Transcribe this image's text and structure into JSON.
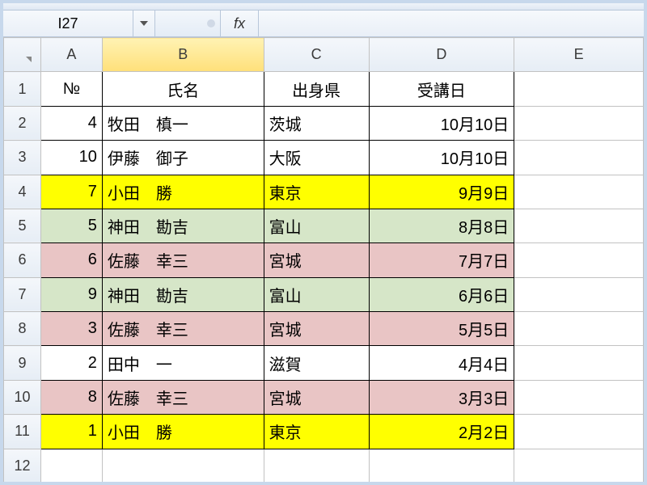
{
  "name_box": "I27",
  "fx_symbol": "fx",
  "columns": [
    "A",
    "B",
    "C",
    "D",
    "E"
  ],
  "selected_column": "B",
  "row_headers": [
    "1",
    "2",
    "3",
    "4",
    "5",
    "6",
    "7",
    "8",
    "9",
    "10",
    "11",
    "12"
  ],
  "header_row": {
    "no": "№",
    "name": "氏名",
    "pref": "出身県",
    "date": "受講日"
  },
  "rows": [
    {
      "no": "4",
      "name": "牧田　槙一",
      "pref": "茨城",
      "date": "10月10日",
      "hl": ""
    },
    {
      "no": "10",
      "name": "伊藤　御子",
      "pref": "大阪",
      "date": "10月10日",
      "hl": ""
    },
    {
      "no": "7",
      "name": "小田　勝",
      "pref": "東京",
      "date": "9月9日",
      "hl": "yellow"
    },
    {
      "no": "5",
      "name": "神田　勘吉",
      "pref": "富山",
      "date": "8月8日",
      "hl": "green"
    },
    {
      "no": "6",
      "name": "佐藤　幸三",
      "pref": "宮城",
      "date": "7月7日",
      "hl": "pink"
    },
    {
      "no": "9",
      "name": "神田　勘吉",
      "pref": "富山",
      "date": "6月6日",
      "hl": "green"
    },
    {
      "no": "3",
      "name": "佐藤　幸三",
      "pref": "宮城",
      "date": "5月5日",
      "hl": "pink"
    },
    {
      "no": "2",
      "name": "田中　一",
      "pref": "滋賀",
      "date": "4月4日",
      "hl": ""
    },
    {
      "no": "8",
      "name": "佐藤　幸三",
      "pref": "宮城",
      "date": "3月3日",
      "hl": "pink"
    },
    {
      "no": "1",
      "name": "小田　勝",
      "pref": "東京",
      "date": "2月2日",
      "hl": "yellow"
    }
  ]
}
